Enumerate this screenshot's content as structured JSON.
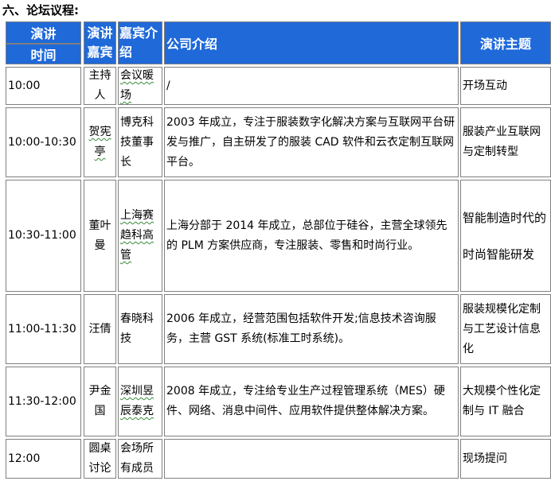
{
  "section_title": "六、论坛议程:",
  "headers": {
    "time_top": "演讲",
    "time_bottom": "时间",
    "speaker": "演讲嘉宾",
    "intro": "嘉宾介绍",
    "company": "公司介绍",
    "topic": "演讲主题"
  },
  "rows": [
    {
      "time": "10:00",
      "speaker": "主持人",
      "intro": "会议暖场",
      "company": "/",
      "topic": "开场互动"
    },
    {
      "time": "10:00-10:30",
      "speaker": "贺宪亭",
      "intro": "博克科技董事长",
      "company": "2003 年成立，专注于服装数字化解决方案与互联网平台研发与推广，自主研发了的服装 CAD 软件和云衣定制互联网平台。",
      "topic": "服装产业互联网与定制转型"
    },
    {
      "time": "10:30-11:00",
      "speaker": "董叶曼",
      "intro": "上海赛趋科高管",
      "company": "上海分部于 2014 年成立，总部位于硅谷，主营全球领先的 PLM 方案供应商，专注服装、零售和时尚行业。",
      "topic": "智能制造时代的时尚智能研发"
    },
    {
      "time": "11:00-11:30",
      "speaker": "汪倩",
      "intro": "春晓科技",
      "company": "2006 年成立，经营范围包括软件开发;信息技术咨询服务，主营 GST 系统(标准工时系统)。",
      "topic": "服装规模化定制与工艺设计信息化"
    },
    {
      "time": "11:30-12:00",
      "speaker": "尹金国",
      "intro": "深圳昱辰泰克",
      "company": "2008 年成立，专注给专业生产过程管理系统（MES）硬件、网络、消息中间件、应用软件提供整体解决方案。",
      "topic": "大规模个性化定制与 IT 融合"
    },
    {
      "time": "12:00",
      "speaker": "圆桌讨论",
      "intro": "会场所有成员",
      "company": "",
      "topic": "现场提问"
    }
  ]
}
